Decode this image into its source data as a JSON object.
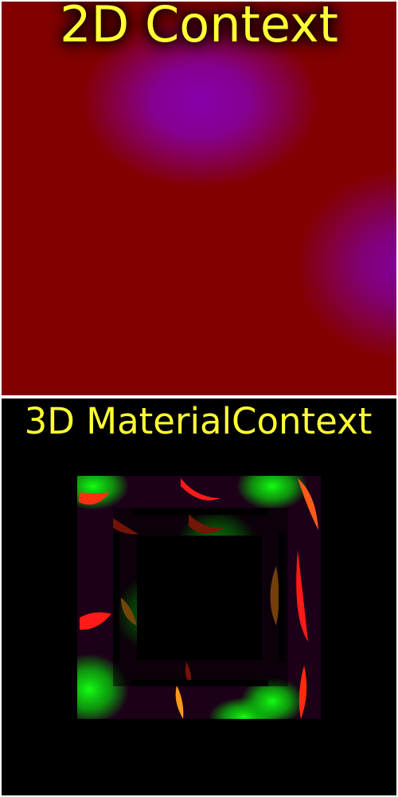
{
  "panels": {
    "top": {
      "title": "2D Context",
      "background": "#830000",
      "blob_color": "#8700aa"
    },
    "bottom": {
      "title": "3D MaterialContext",
      "background": "#000000"
    }
  },
  "colors": {
    "title": "#ffff33",
    "green": "#10ff10",
    "red": "#ff1a1a",
    "orange": "#ff8c1a",
    "dark": "#1a0014"
  }
}
